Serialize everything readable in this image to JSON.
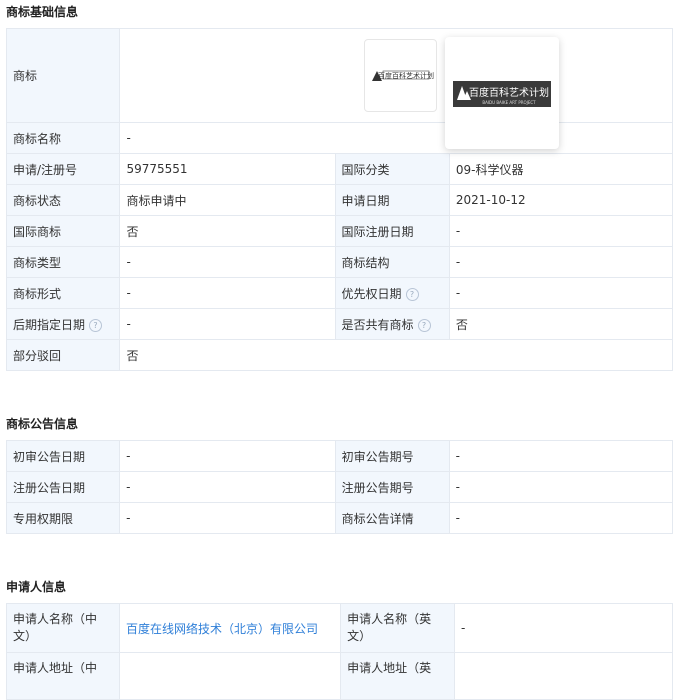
{
  "basic": {
    "title": "商标基础信息",
    "rows": [
      {
        "l1": "商标",
        "v1": ""
      },
      {
        "l1": "商标名称",
        "v1": "-"
      },
      {
        "l1": "申请/注册号",
        "v1": "59775551",
        "l2": "国际分类",
        "v2": "09-科学仪器"
      },
      {
        "l1": "商标状态",
        "v1": "商标申请中",
        "l2": "申请日期",
        "v2": "2021-10-12"
      },
      {
        "l1": "国际商标",
        "v1": "否",
        "l2": "国际注册日期",
        "v2": "-"
      },
      {
        "l1": "商标类型",
        "v1": "-",
        "l2": "商标结构",
        "v2": "-"
      },
      {
        "l1": "商标形式",
        "v1": "-",
        "l2": "优先权日期",
        "v2": "-"
      },
      {
        "l1": "后期指定日期",
        "v1": "-",
        "l2": "是否共有商标",
        "v2": "否"
      },
      {
        "l1": "部分驳回",
        "v1": "否"
      }
    ],
    "logo_text": "百度百科艺术计划",
    "logo_subtext": "BAIDU BAIKE ART PROJECT"
  },
  "announce": {
    "title": "商标公告信息",
    "rows": [
      {
        "l1": "初审公告日期",
        "v1": "-",
        "l2": "初审公告期号",
        "v2": "-"
      },
      {
        "l1": "注册公告日期",
        "v1": "-",
        "l2": "注册公告期号",
        "v2": "-"
      },
      {
        "l1": "专用权期限",
        "v1": "-",
        "l2": "商标公告详情",
        "v2": "-"
      }
    ]
  },
  "applicant": {
    "title": "申请人信息",
    "rows": [
      {
        "l1": "申请人名称（中文）",
        "v1": "百度在线网络技术（北京）有限公司",
        "l2": "申请人名称（英文）",
        "v2": "-"
      },
      {
        "l1": "申请人地址（中",
        "v1": "",
        "l2": "申请人地址（英",
        "v2": ""
      }
    ]
  },
  "help_glyph": "?"
}
